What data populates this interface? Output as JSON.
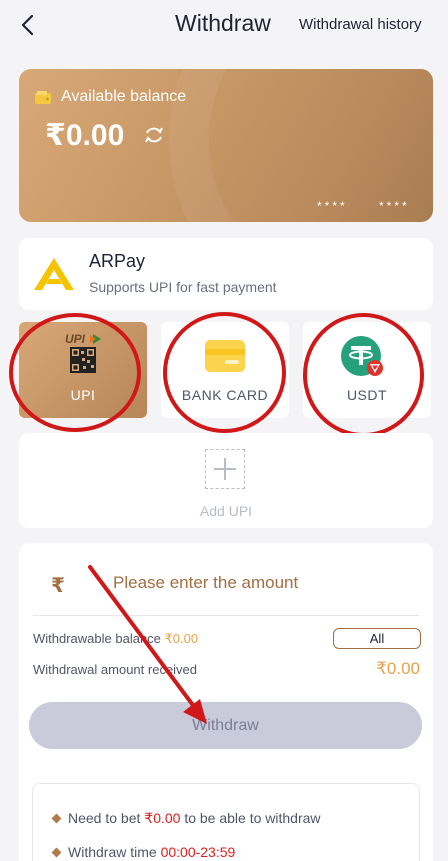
{
  "header": {
    "title": "Withdraw",
    "history_label": "Withdrawal history"
  },
  "balance": {
    "label": "Available balance",
    "amount": "₹0.00",
    "masked_1": "****",
    "masked_2": "****"
  },
  "payment": {
    "name": "ARPay",
    "description": "Supports UPI for fast payment"
  },
  "methods": [
    {
      "label": "UPI",
      "selected": true
    },
    {
      "label": "BANK CARD",
      "selected": false
    },
    {
      "label": "USDT",
      "selected": false
    }
  ],
  "add_upi": {
    "label": "Add UPI"
  },
  "amount": {
    "currency_symbol": "₹",
    "placeholder": "Please enter the amount",
    "withdrawable_label": "Withdrawable balance ",
    "withdrawable_value": "₹0.00",
    "all_label": "All",
    "received_label": "Withdrawal amount received",
    "received_value": "₹0.00",
    "withdraw_label": "Withdraw"
  },
  "rules": [
    {
      "pre": "Need to bet ",
      "value": "₹0.00",
      "post": " to be able to withdraw"
    },
    {
      "pre": "Withdraw time ",
      "value": "00:00-23:59",
      "post": ""
    }
  ],
  "colors": {
    "accent": "#a06f42",
    "highlight": "#e8a24a",
    "annotation": "#d01818"
  }
}
